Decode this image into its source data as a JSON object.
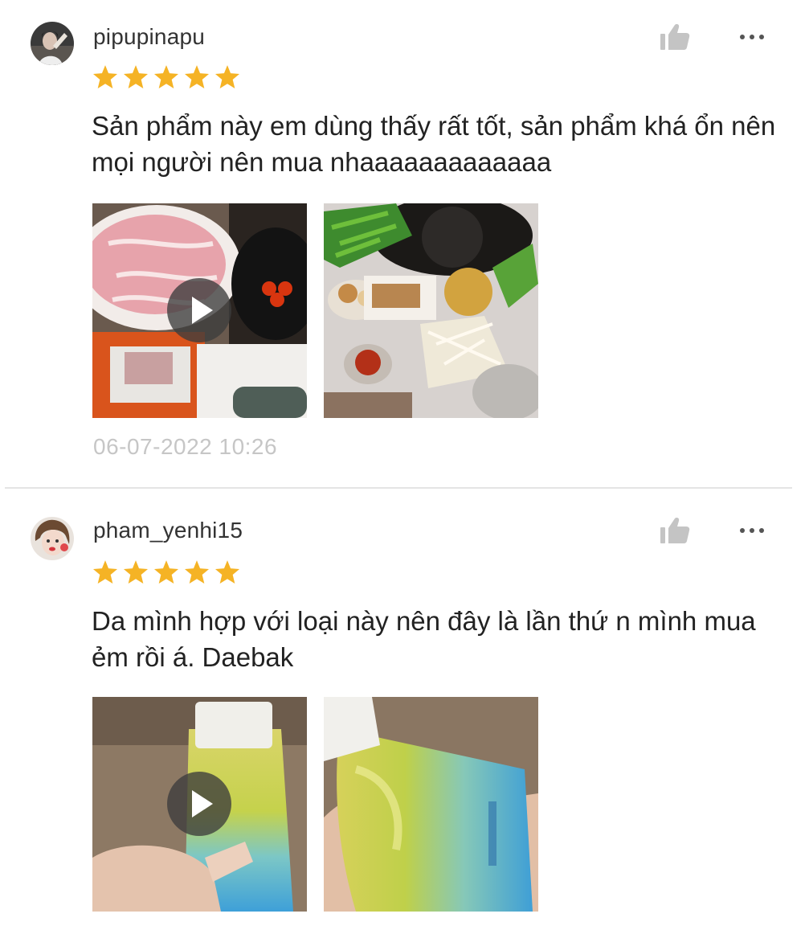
{
  "accent_colors": {
    "star": "#f5b325",
    "icon_gray": "#c4c4c4",
    "timestamp": "#c6c6c6",
    "divider": "#e4e4e4"
  },
  "reviews": [
    {
      "username": "pipupinapu",
      "rating": 5,
      "comment": "Sản phẩm này em dùng thấy rất tốt, sản phẩm khá ổn nên mọi người nên mua nhaaaaaaaaaaaaa",
      "timestamp": "06-07-2022 10:26",
      "media": [
        {
          "kind": "video",
          "icon": "play-icon"
        },
        {
          "kind": "image"
        }
      ]
    },
    {
      "username": "pham_yenhi15",
      "rating": 5,
      "comment": "Da mình hợp với loại này nên đây là lần thứ n mình mua ẻm rồi á. Daebak",
      "media": [
        {
          "kind": "video",
          "icon": "play-icon"
        },
        {
          "kind": "image"
        }
      ]
    }
  ],
  "icons": {
    "like": "thumbs-up-icon",
    "more": "more-dots-icon",
    "star": "star-icon"
  }
}
